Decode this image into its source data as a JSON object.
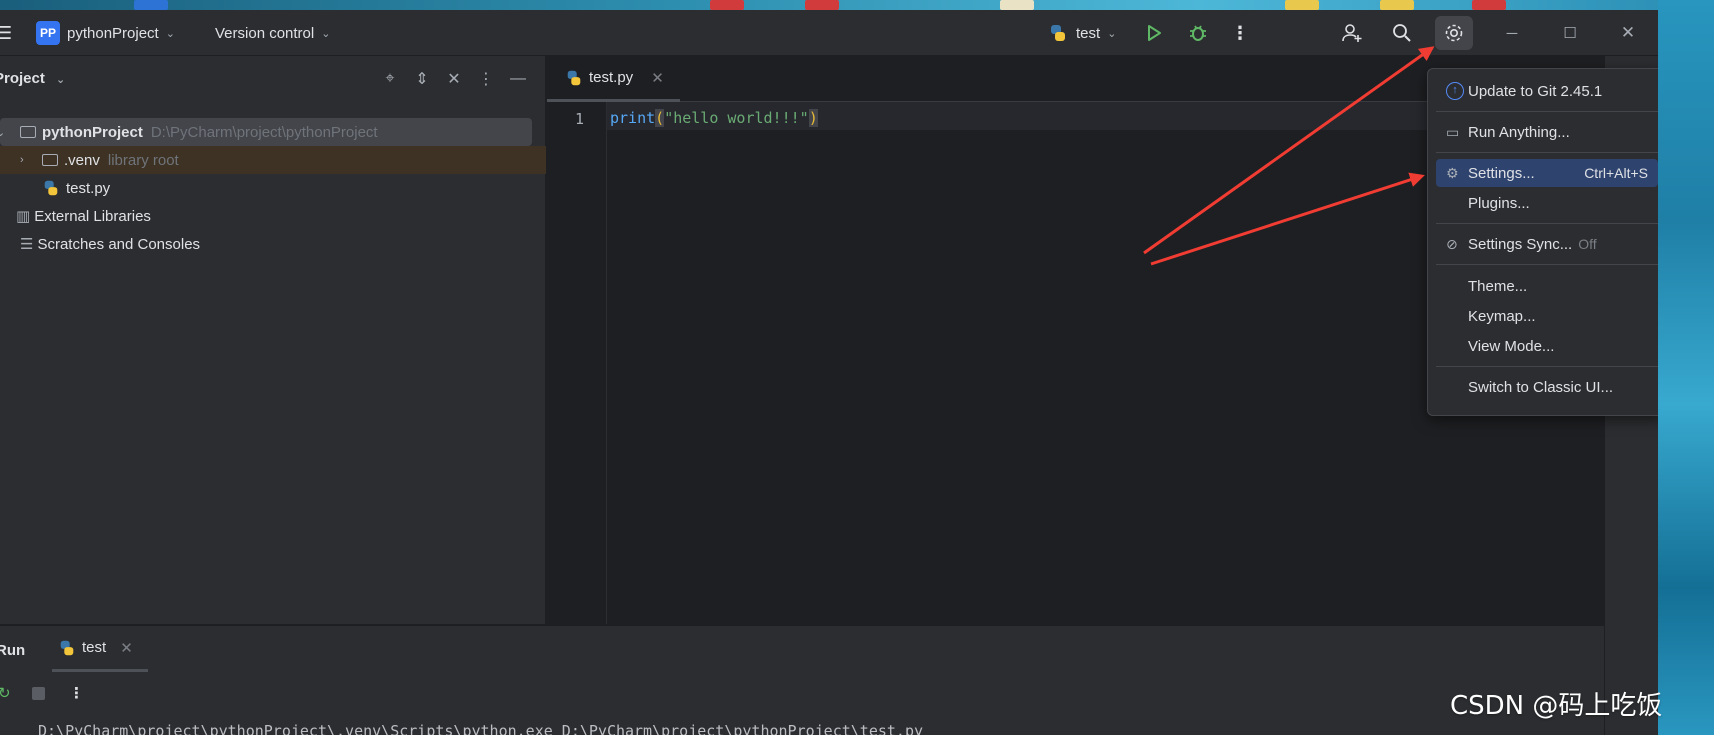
{
  "titlebar": {
    "project_badge": "PP",
    "project_name": "pythonProject",
    "version_control": "Version control",
    "run_config": "test",
    "icons": [
      "hamburger-icon",
      "run-icon",
      "debug-icon",
      "more-icon",
      "add-user-icon",
      "search-icon",
      "gear-icon",
      "minimize-icon",
      "maximize-icon",
      "close-icon"
    ]
  },
  "project_pane": {
    "title": "Project",
    "tree": [
      {
        "label": "pythonProject",
        "path": "D:\\PyCharm\\project\\pythonProject"
      },
      {
        "label": ".venv",
        "hint": "library root"
      },
      {
        "label": "test.py"
      },
      {
        "label": "External Libraries"
      },
      {
        "label": "Scratches and Consoles"
      }
    ]
  },
  "editor": {
    "tab_label": "test.py",
    "line_number": "1",
    "code": {
      "fn": "print",
      "open": "(",
      "str": "\"hello world!!!\"",
      "close": ")"
    }
  },
  "menu": {
    "items": [
      {
        "label": "Update to Git 2.45.1",
        "icon": "git-update-icon"
      },
      {
        "label": "Run Anything...",
        "icon": "run-anything-icon"
      },
      {
        "label": "Settings...",
        "icon": "gear-icon",
        "shortcut": "Ctrl+Alt+S",
        "selected": true
      },
      {
        "label": "Plugins..."
      },
      {
        "label": "Settings Sync...",
        "icon": "sync-off-icon",
        "status": "Off"
      },
      {
        "label": "Theme..."
      },
      {
        "label": "Keymap..."
      },
      {
        "label": "View Mode..."
      },
      {
        "label": "Switch to Classic UI..."
      }
    ]
  },
  "run_panel": {
    "title": "Run",
    "tab_label": "test",
    "console_line": "D:\\PyCharm\\project\\pythonProject\\.venv\\Scripts\\python.exe D:\\PyCharm\\project\\pythonProject\\test.py"
  },
  "watermark": "CSDN @码上吃饭",
  "colors": {
    "accent": "#3574f0",
    "selection": "#2e436e",
    "arrow": "#f03c32",
    "run_green": "#5fb865"
  }
}
